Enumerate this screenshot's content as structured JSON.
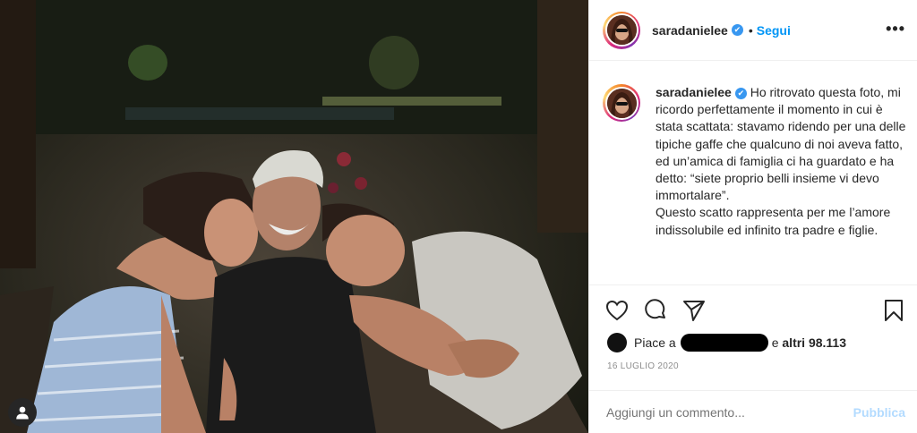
{
  "post": {
    "username": "saradanielee",
    "verified_mark": "✔",
    "dot": "•",
    "follow_label": "Segui",
    "more_label": "•••",
    "caption_lines": "Ho ritrovato questa foto, mi ricordo perfettamente il momento in cui è stata scattata: stavamo ridendo per una delle tipiche gaffe che qualcuno di noi aveva fatto, ed un’amica di famiglia ci ha guardato e ha detto: “siete proprio belli insieme vi devo immortalare”.\nQuesto scatto rappresenta per me l’amore indissolubile ed infinito tra padre e figlie.",
    "likes_prefix": "Piace a",
    "likes_and": "e",
    "likes_count": "altri 98.113",
    "date": "16 LUGLIO 2020",
    "comment_placeholder": "Aggiungi un commento...",
    "publish_label": "Pubblica"
  },
  "icons": {
    "like": "heart-icon",
    "comment": "comment-icon",
    "share": "paper-plane-icon",
    "save": "bookmark-icon",
    "tag": "user-tag-icon"
  },
  "colors": {
    "link_blue": "#0095f6",
    "publish_disabled": "#b3dbff",
    "muted": "#8e8e8e",
    "text": "#262626"
  }
}
